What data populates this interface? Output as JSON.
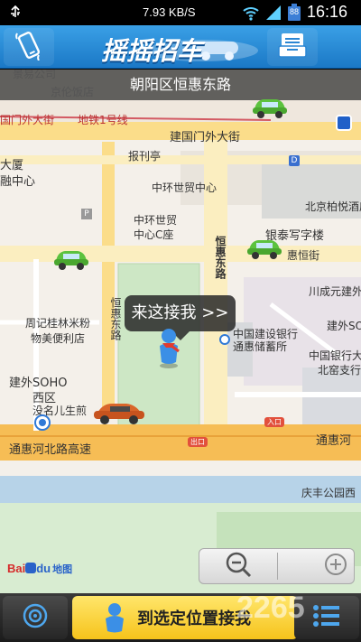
{
  "status_bar": {
    "speed": "7.93 KB/S",
    "battery": "88",
    "time": "16:16"
  },
  "header": {
    "logo_text": "摇摇招车"
  },
  "map": {
    "location": "朝阳区恒惠东路",
    "labels": {
      "jingpeng": "景易公司",
      "jinglun": "京伦饭店",
      "jianguomenwai_west": "国门外大街",
      "subway_line1": "地铁1号线",
      "jianguomenwai": "建国门外大街",
      "baokanting": "报刊亭",
      "dasha": "大厦",
      "rongzhongxin": "融中心",
      "zhonghuan": "中环世贸中心",
      "zhonghuan_c1": "中环世贸",
      "zhonghuan_c2": "中心C座",
      "beijing_bairui": "北京柏悦酒店",
      "yintai": "银泰写字楼",
      "huiheng": "惠恒街",
      "hengh_e1": "恒惠东路",
      "hengh_e2": "恒惠东路",
      "chuangcheng": "川成元建外",
      "jianwai_so": "建外SO",
      "zhouji1": "周记桂林米粉",
      "zhouji2": "物美便利店",
      "ccb1": "中国建设银行",
      "ccb2": "通惠储蓄所",
      "boc1": "中国银行大",
      "boc2": "北窑支行",
      "soho1": "建外SOHO",
      "soho2": "西区",
      "meisheng": "没名儿生煎",
      "tonghui_hwy": "通惠河北路高速",
      "tonghui_east": "通惠河",
      "qingfeng": "庆丰公园西",
      "rukou": "入口",
      "chukou": "出口"
    },
    "pickup_bubble": "来这接我 >>",
    "baidu_brand_1": "Bai",
    "baidu_brand_2": "du",
    "baidu_brand_3": "地图"
  },
  "bottom_bar": {
    "locate_label": "定位",
    "confirm_label": "到选定位置接我",
    "menu_label": "菜单"
  },
  "watermark": "2265"
}
